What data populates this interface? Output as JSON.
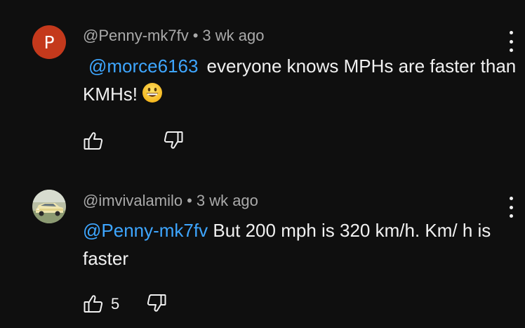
{
  "comments": [
    {
      "avatar_letter": "P",
      "avatar_color": "#c4391c",
      "username": "@Penny-mk7fv",
      "separator": "•",
      "time": "3 wk ago",
      "mention": "@morce6163",
      "text": "everyone knows MPHs are faster than KMHs!",
      "emoji": "grinning-face-emoji",
      "like_count": "",
      "like_icon": "thumbs-up-icon",
      "dislike_icon": "thumbs-down-icon",
      "menu_icon": "more-vertical-icon"
    },
    {
      "avatar_image": "car-photo",
      "username": "@imvivalamilo",
      "separator": "•",
      "time": "3 wk ago",
      "mention": "@Penny-mk7fv",
      "text": " But 200 mph is 320 km/h. Km/ h is faster",
      "like_count": "5",
      "like_icon": "thumbs-up-icon",
      "dislike_icon": "thumbs-down-icon",
      "menu_icon": "more-vertical-icon"
    }
  ],
  "colors": {
    "background": "#0f0f0f",
    "mention": "#3ea6ff",
    "meta": "#aaaaaa",
    "text": "#f1f1f1"
  }
}
